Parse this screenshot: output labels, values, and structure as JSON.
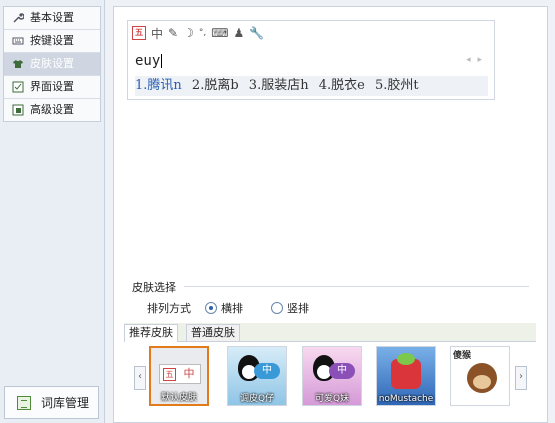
{
  "sidebar": {
    "items": [
      {
        "label": "基本设置",
        "icon": "wrench-icon"
      },
      {
        "label": "按键设置",
        "icon": "keyboard-icon"
      },
      {
        "label": "皮肤设置",
        "icon": "shirt-icon"
      },
      {
        "label": "界面设置",
        "icon": "window-icon"
      },
      {
        "label": "高级设置",
        "icon": "advanced-icon"
      }
    ],
    "active_index": 2,
    "ciku_label": "词库管理"
  },
  "ime_preview": {
    "toolbar_icons": [
      "logo-icon",
      "chinese-mode-icon",
      "pen-icon",
      "moon-icon",
      "punctuation-icon",
      "keyboard-icon",
      "user-icon",
      "wrench-icon"
    ],
    "mode_char": "中",
    "composition": "euy",
    "candidates": [
      "1.腾讯n",
      "2.脱离b",
      "3.服装店h",
      "4.脱衣e",
      "5.胶州t"
    ]
  },
  "skin_section": {
    "title": "皮肤选择",
    "order_label": "排列方式",
    "options": [
      "横排",
      "竖排"
    ],
    "selected_option": "横排",
    "tabs": [
      "推荐皮肤",
      "普通皮肤"
    ],
    "active_tab": "推荐皮肤",
    "skins": [
      {
        "name": "默认皮肤",
        "selected": true
      },
      {
        "name": "调皮Q仔",
        "selected": false
      },
      {
        "name": "可爱Q妹",
        "selected": false
      },
      {
        "name": "noMustache",
        "selected": false
      },
      {
        "name": "傻猴",
        "selected": false
      }
    ],
    "logo_text": "五",
    "mode_char": "中",
    "monkey_caption": "傻猴"
  }
}
